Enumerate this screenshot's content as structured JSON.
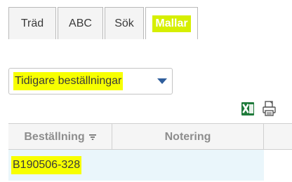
{
  "tabs": [
    {
      "label": "Träd"
    },
    {
      "label": "ABC"
    },
    {
      "label": "Sök"
    },
    {
      "label": "Mallar",
      "active": true
    }
  ],
  "dropdown": {
    "selected": "Tidigare beställningar"
  },
  "toolbar": {
    "excel_icon": "excel-export-icon",
    "print_icon": "print-icon"
  },
  "table": {
    "columns": [
      "Beställning",
      "Notering"
    ],
    "rows": [
      {
        "order": "B190506-328",
        "note": ""
      }
    ]
  },
  "colors": {
    "highlight_yellow": "#f7ff00",
    "active_tab_highlight": "#d6ef00",
    "dropdown_arrow": "#2f5e9c",
    "excel_green": "#1e7a3a",
    "row_background": "#eaf6fb"
  }
}
